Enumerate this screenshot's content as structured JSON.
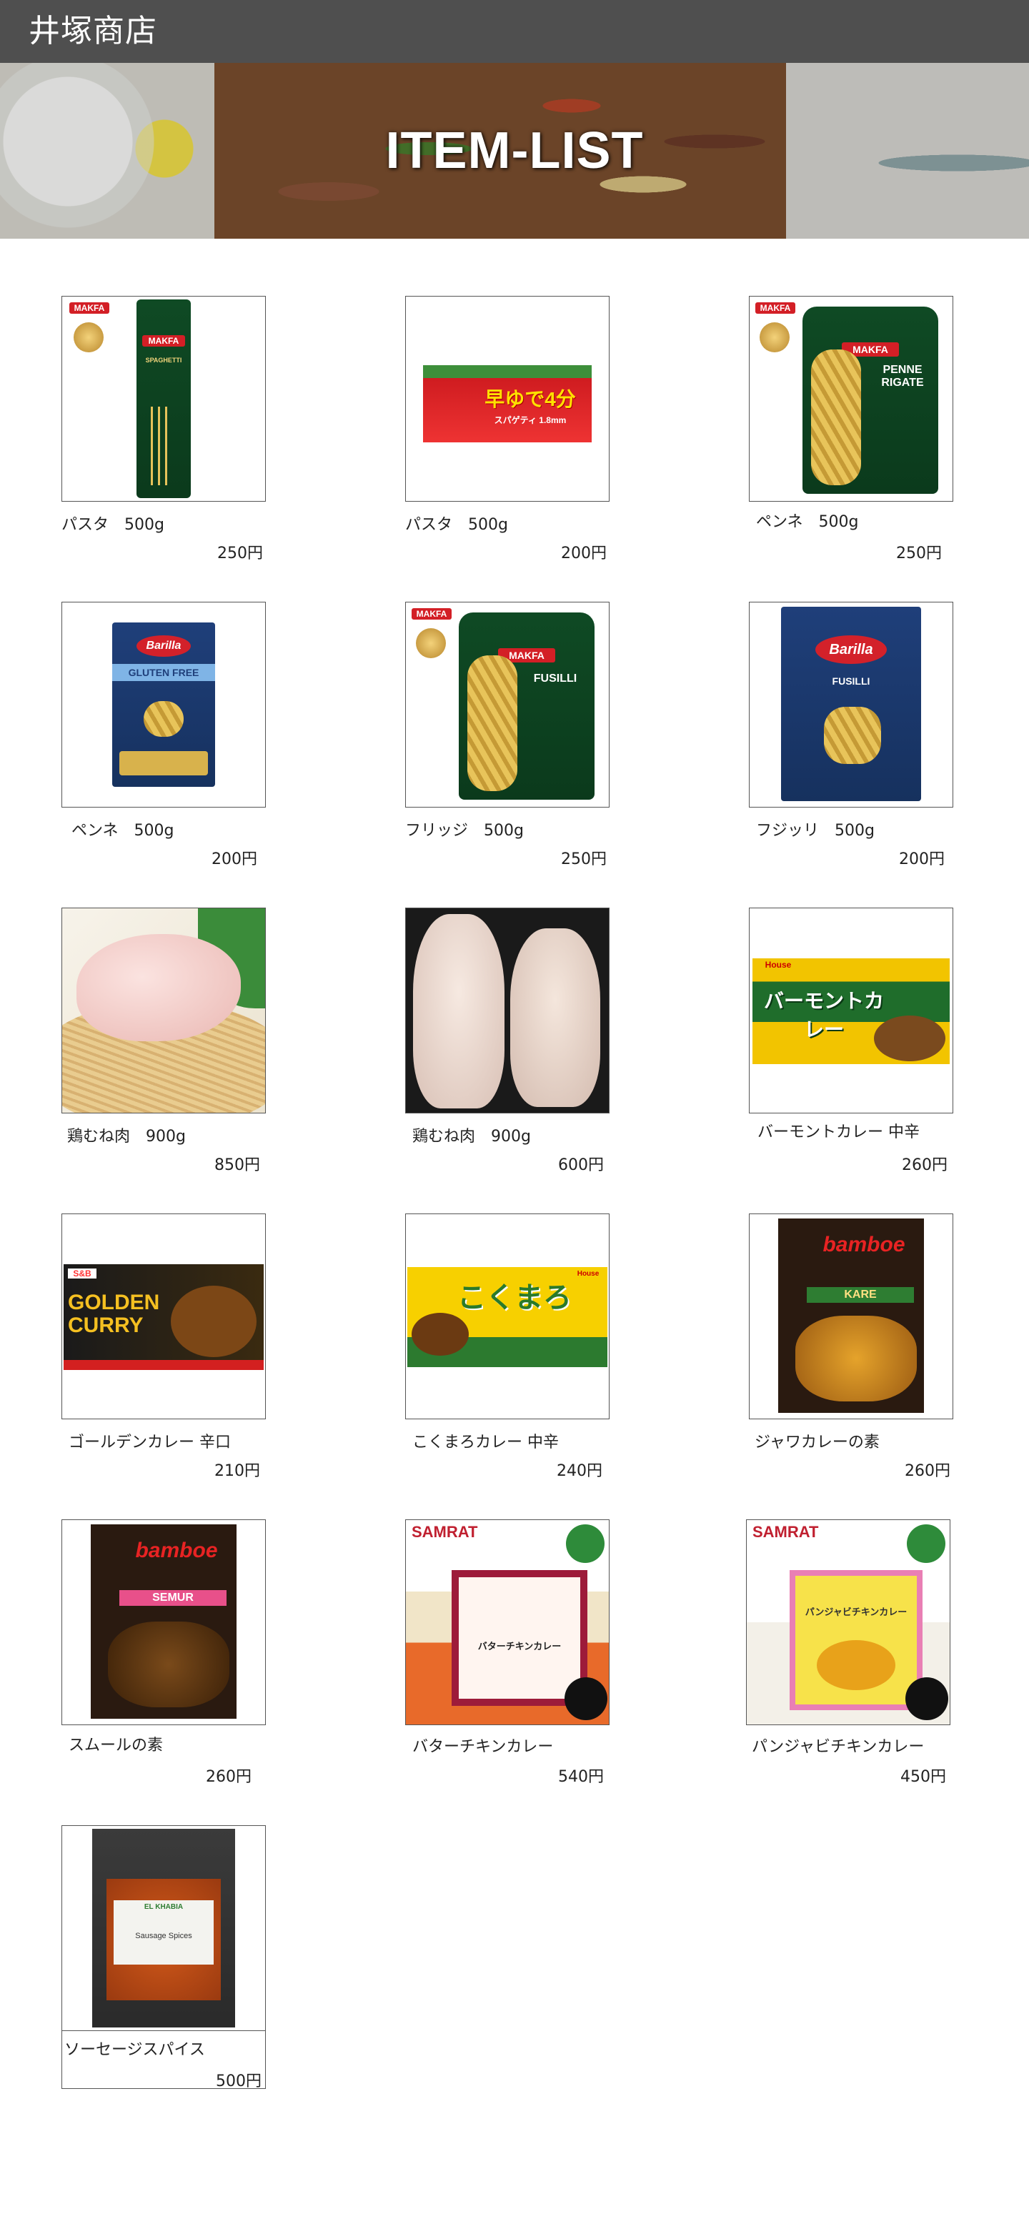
{
  "header": {
    "store_name": "井塚商店"
  },
  "hero": {
    "title": "ITEM-LIST"
  },
  "products": [
    {
      "name": "パスタ　500g",
      "price": "250円",
      "art": "makfa-spaghetti",
      "brand": "MAKFA",
      "product": "SPAGHETTI"
    },
    {
      "name": "パスタ　500g",
      "price": "200円",
      "art": "hayayude",
      "brand": "早ゆで4分",
      "product": "スパゲティ 1.8mm"
    },
    {
      "name": "ペンネ　500g",
      "price": "250円",
      "art": "makfa-penne",
      "brand": "MAKFA",
      "product": "PENNE RIGATE"
    },
    {
      "name": "ペンネ　500g",
      "price": "200円",
      "art": "barilla-gf",
      "brand": "Barilla",
      "product": "GLUTEN FREE"
    },
    {
      "name": "フリッジ　500g",
      "price": "250円",
      "art": "makfa-fusilli",
      "brand": "MAKFA",
      "product": "FUSILLI"
    },
    {
      "name": "フジッリ　500g",
      "price": "200円",
      "art": "barilla-fusilli",
      "brand": "Barilla",
      "product": "FUSILLI"
    },
    {
      "name": "鶏むね肉　900g",
      "price": "850円",
      "art": "chicken1",
      "brand": "",
      "product": ""
    },
    {
      "name": "鶏むね肉　900g",
      "price": "600円",
      "art": "chicken2",
      "brand": "",
      "product": ""
    },
    {
      "name": "バーモントカレー 中辛",
      "price": "260円",
      "art": "vermont",
      "brand": "House",
      "product": "バーモントカレー"
    },
    {
      "name": "ゴールデンカレー 辛口",
      "price": "210円",
      "art": "golden",
      "brand": "S&B",
      "product": "GOLDEN CURRY"
    },
    {
      "name": "こくまろカレー 中辛",
      "price": "240円",
      "art": "kokumaro",
      "brand": "House",
      "product": "こくまろ"
    },
    {
      "name": "ジャワカレーの素",
      "price": "260円",
      "art": "bamboe-kare",
      "brand": "bamboe",
      "product": "KARE"
    },
    {
      "name": "スムールの素",
      "price": "260円",
      "art": "bamboe-semur",
      "brand": "bamboe",
      "product": "SEMUR"
    },
    {
      "name": "バターチキンカレー",
      "price": "540円",
      "art": "samrat-butter",
      "brand": "SAMRAT",
      "product": "バターチキンカレー"
    },
    {
      "name": "パンジャビチキンカレー",
      "price": "450円",
      "art": "samrat-punjabi",
      "brand": "SAMRAT",
      "product": "パンジャビチキンカレー"
    },
    {
      "name": "ソーセージスパイス",
      "price": "500円",
      "art": "sausage",
      "brand": "EL KHABIA",
      "product": "Sausage Spices"
    }
  ],
  "colors": {
    "header_bg": "#4f4f4f",
    "header_text": "#ffffff",
    "page_bg": "#ffffff",
    "border": "#555555"
  }
}
